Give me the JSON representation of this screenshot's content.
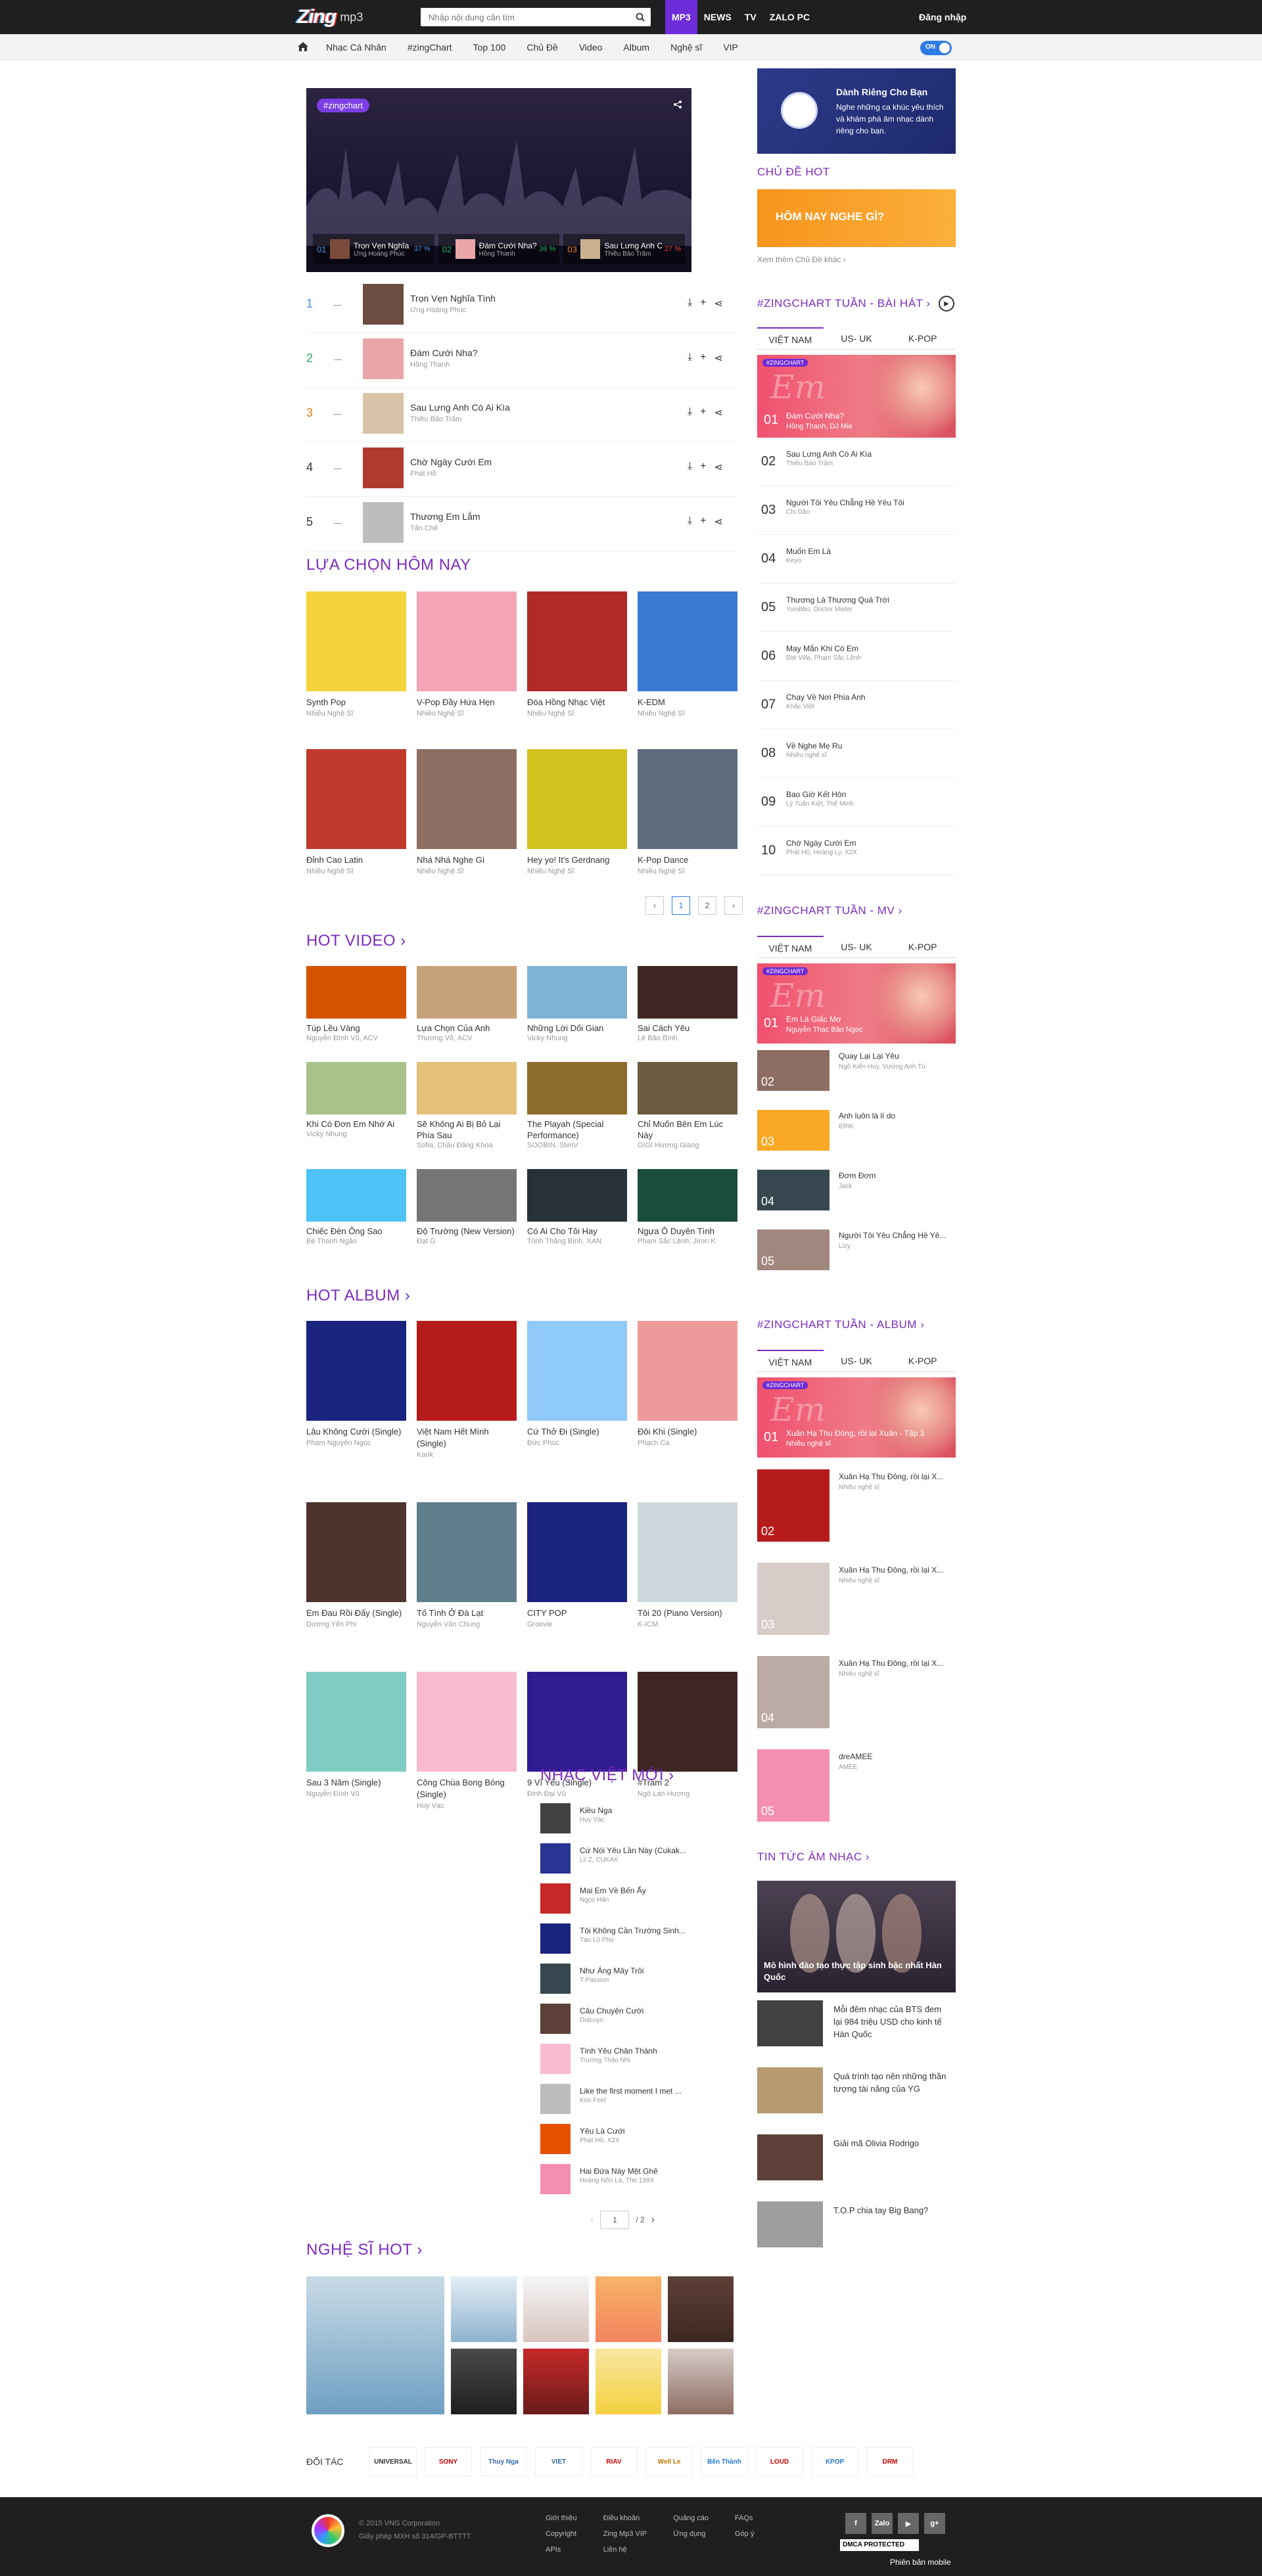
{
  "header": {
    "logo_main": "Zing",
    "logo_sub": "mp3",
    "search_placeholder": "Nhập nội dung cần tìm",
    "nav": [
      "MP3",
      "NEWS",
      "TV",
      "ZALO PC"
    ],
    "login": "Đăng nhập"
  },
  "subnav": [
    "Nhạc Cá Nhân",
    "#zingChart",
    "Top 100",
    "Chủ Đề",
    "Video",
    "Album",
    "Nghệ sĩ",
    "VIP"
  ],
  "toggle_label": "ON",
  "chart": {
    "badge": "#zingchart",
    "top3": [
      {
        "rank": "01",
        "name": "Trọn Vẹn Nghĩa ...",
        "artist": "Ưng Hoàng Phúc",
        "pct": "37 %"
      },
      {
        "rank": "02",
        "name": "Đám Cưới Nha?",
        "artist": "Hồng Thanh",
        "pct": "36 %"
      },
      {
        "rank": "03",
        "name": "Sau Lưng Anh C...",
        "artist": "Thiều Bảo Trâm",
        "pct": "27 %"
      }
    ],
    "list": [
      {
        "rank": "1",
        "name": "Trọn Vẹn Nghĩa Tình",
        "artist": "Ưng Hoàng Phúc",
        "color": "#4a90e2"
      },
      {
        "rank": "2",
        "name": "Đám Cưới Nha?",
        "artist": "Hồng Thanh",
        "color": "#27ae60"
      },
      {
        "rank": "3",
        "name": "Sau Lưng Anh Có Ai Kìa",
        "artist": "Thiều Bảo Trâm",
        "color": "#e67e22"
      },
      {
        "rank": "4",
        "name": "Chờ Ngày Cưới Em",
        "artist": "Phát Hồ",
        "color": "#333333"
      },
      {
        "rank": "5",
        "name": "Thương Em Lắm",
        "artist": "Tấn Chế",
        "color": "#333333"
      }
    ]
  },
  "today": {
    "title": "LỰA CHỌN HÔM NAY",
    "items": [
      {
        "t": "Synth Pop",
        "m": "Nhiều Nghệ Sĩ",
        "bg": "#f5d33a"
      },
      {
        "t": "V-Pop Đầy Hứa Hẹn",
        "m": "Nhiều Nghệ Sĩ",
        "bg": "#f4a4b6"
      },
      {
        "t": "Đóa Hồng Nhạc Việt",
        "m": "Nhiều Nghệ Sĩ",
        "bg": "#b02a2a"
      },
      {
        "t": "K-EDM",
        "m": "Nhiều Nghệ Sĩ",
        "bg": "#3a7bd5"
      },
      {
        "t": "Đỉnh Cao Latin",
        "m": "Nhiều Nghệ Sĩ",
        "bg": "#c0392b"
      },
      {
        "t": "Nhá Nhá Nghe Gì",
        "m": "Nhiều Nghệ Sĩ",
        "bg": "#8d6e63"
      },
      {
        "t": "Hey yo! It's Gerdnang",
        "m": "Nhiều Nghệ Sĩ",
        "bg": "#d4c21e"
      },
      {
        "t": "K-Pop Dance",
        "m": "Nhiều Nghệ Sĩ",
        "bg": "#5d6d7e"
      }
    ],
    "pages": [
      "1",
      "2"
    ]
  },
  "hot_video": {
    "title": "HOT VIDEO",
    "items": [
      {
        "t": "Túp Lều Vàng",
        "m": "Nguyễn Đình Vũ, ACV",
        "bg": "#d35400"
      },
      {
        "t": "Lựa Chọn Của Anh",
        "m": "Thương Võ, ACV",
        "bg": "#c8a27a"
      },
      {
        "t": "Những Lời Dối Gian",
        "m": "Vicky Nhung",
        "bg": "#7fb3d5"
      },
      {
        "t": "Sai Cách Yêu",
        "m": "Lê Bảo Bình",
        "bg": "#3e2723"
      },
      {
        "t": "Khi Có Đơn Em Nhớ Ai",
        "m": "Vicky Nhung",
        "bg": "#a9c18b"
      },
      {
        "t": "Sẽ Không Ai Bị Bỏ Lại Phía Sau",
        "m": "Sofia, Châu Đăng Khoa",
        "bg": "#e5c07b"
      },
      {
        "t": "The Playah (Special Performance)",
        "m": "SOOBIN, SlimV",
        "bg": "#8e6b2e"
      },
      {
        "t": "Chỉ Muốn Bên Em Lúc Này",
        "m": "GIGI Hương Giang",
        "bg": "#6b5b3e"
      },
      {
        "t": "Chiếc Đèn Ông Sao",
        "m": "Bé Thanh Ngân",
        "bg": "#4fc3f7"
      },
      {
        "t": "Độ Trường (New Version)",
        "m": "Đạt G",
        "bg": "#757575"
      },
      {
        "t": "Có Ai Cho Tôi Hay",
        "m": "Trịnh Thăng Bình, XAN",
        "bg": "#263238"
      },
      {
        "t": "Ngựa Ô Duyên Tình",
        "m": "Phạm Sắc Lệnh, Jiron K",
        "bg": "#1b4d3e"
      }
    ]
  },
  "hot_album": {
    "title": "HOT ALBUM",
    "items": [
      {
        "t": "Lâu Không Cười (Single)",
        "m": "Phạm Nguyên Ngọc",
        "bg": "#1a237e"
      },
      {
        "t": "Việt Nam Hết Mình (Single)",
        "m": "Karik",
        "bg": "#b71c1c"
      },
      {
        "t": "Cứ Thở Đi (Single)",
        "m": "Đức Phúc",
        "bg": "#90caf9"
      },
      {
        "t": "Đôi Khi (Single)",
        "m": "Phạch Ca",
        "bg": "#ef9a9a"
      },
      {
        "t": "Em Đau Rồi Đấy (Single)",
        "m": "Dương Yến Phi",
        "bg": "#4e342e"
      },
      {
        "t": "Tố Tình Ở Đà Lạt",
        "m": "Nguyễn Văn Chung",
        "bg": "#607d8b"
      },
      {
        "t": "CITY POP",
        "m": "Groovie",
        "bg": "#1a237e"
      },
      {
        "t": "Tôi 20 (Piano Version)",
        "m": "K-ICM",
        "bg": "#cfd8dc"
      },
      {
        "t": "Sau 3 Năm (Single)",
        "m": "Nguyễn Đình Vũ",
        "bg": "#80cbc4"
      },
      {
        "t": "Công Chúa Bong Bóng (Single)",
        "m": "Huy Vạc",
        "bg": "#f8bbd0"
      },
      {
        "t": "9 Vì Yêu (Single)",
        "m": "Đinh Đại Vũ",
        "bg": "#311b92"
      },
      {
        "t": "#Trăm 2",
        "m": "Ngô Lan Hương",
        "bg": "#3e2723"
      }
    ]
  },
  "new_vn": {
    "title": "NHẠC VIỆT MỚI",
    "items": [
      {
        "t": "Kiều Nga",
        "m": "Huy Vạc",
        "bg": "#424242"
      },
      {
        "t": "Cứ Nói Yêu Lần Này (Cukak...",
        "m": "Lil Z, CUKAK",
        "bg": "#283593"
      },
      {
        "t": "Mai Em Về Bến Ấy",
        "m": "Ngọc Hân",
        "bg": "#c62828"
      },
      {
        "t": "Tôi Không Cần Trường Sinh...",
        "m": "Tào Lộ Phú",
        "bg": "#1a237e"
      },
      {
        "t": "Như Áng Mây Trôi",
        "m": "T-Passion",
        "bg": "#37474f"
      },
      {
        "t": "Câu Chuyện Cười",
        "m": "Dulcoyn",
        "bg": "#5d4037"
      },
      {
        "t": "Tình Yêu Chân Thành",
        "m": "Trương Thảo Nhi",
        "bg": "#f8bbd0"
      },
      {
        "t": "Like the first moment I met ...",
        "m": "Kim Feel",
        "bg": "#bdbdbd"
      },
      {
        "t": "Yêu Là Cưới",
        "m": "Phát Hồ, X2X",
        "bg": "#e65100"
      },
      {
        "t": "Hai Đứa Này Mệt Ghê",
        "m": "Hoàng Nôn Lá, The 199X",
        "bg": "#f48fb1"
      }
    ],
    "page": "1",
    "total": "/ 2"
  },
  "artists": {
    "title": "NGHỆ SĨ HOT"
  },
  "partners": {
    "label": "ĐỐI TÁC",
    "logos": [
      "UNIVERSAL",
      "SONY",
      "Thuy Nga",
      "VIET",
      "RIAV",
      "Well Le",
      "Bến Thành",
      "LOUD",
      "KPOP",
      "DRM"
    ]
  },
  "sidebar": {
    "vip_title": "Dành Riêng Cho Bạn",
    "vip_desc": "Nghe những ca khúc yêu thích và khám phá âm nhạc dành riêng cho bạn.",
    "topic_title": "CHỦ ĐỀ HOT",
    "topic_banner": "HÔM NAY NGHE GÌ?",
    "topic_more": "Xem thêm Chủ Đề khác",
    "tabs": [
      "VIỆT NAM",
      "US- UK",
      "K-POP"
    ],
    "songs_title": "#ZINGCHART TUẦN - BÀI HÁT",
    "songs": [
      {
        "rank": "01",
        "name": "Đám Cưới Nha?",
        "artist": "Hồng Thanh, DJ Mie"
      },
      {
        "rank": "02",
        "name": "Sau Lưng Anh Có Ai Kìa",
        "artist": "Thiều Bảo Trâm"
      },
      {
        "rank": "03",
        "name": "Người Tôi Yêu Chẳng Hề Yêu Tôi",
        "artist": "Chi Dân"
      },
      {
        "rank": "04",
        "name": "Muốn Em Là",
        "artist": "Keyo"
      },
      {
        "rank": "05",
        "name": "Thương Là Thương Quá Trời",
        "artist": "Yunibbo, Doctor Mister"
      },
      {
        "rank": "06",
        "name": "May Mắn Khi Có Em",
        "artist": "Đạt Villa, Phạm Sắc Lệnh"
      },
      {
        "rank": "07",
        "name": "Chạy Về Nơi Phía Anh",
        "artist": "Khắc Việt"
      },
      {
        "rank": "08",
        "name": "Về Nghe Mẹ Ru",
        "artist": "Nhiều nghệ sĩ"
      },
      {
        "rank": "09",
        "name": "Bao Giờ Kết Hôn",
        "artist": "Lý Tuấn Kiệt, Thế Minh"
      },
      {
        "rank": "10",
        "name": "Chờ Ngày Cưới Em",
        "artist": "Phát Hồ, Hoàng Ly, X2X"
      }
    ],
    "mv_title": "#ZINGCHART TUẦN - MV",
    "mvs": [
      {
        "rank": "01",
        "name": "Em Là Giấc Mơ",
        "artist": "Nguyễn Thạc Bảo Ngọc",
        "bg": "#ef6f7a"
      },
      {
        "rank": "02",
        "name": "Quay Lại Lại Yêu",
        "artist": "Ngô Kiến Huy, Vương Anh Tú",
        "bg": "#8d6e63"
      },
      {
        "rank": "03",
        "name": "Anh luôn là lí do",
        "artist": "ERIK",
        "bg": "#f9a825"
      },
      {
        "rank": "04",
        "name": "Đơm Đơm",
        "artist": "Jack",
        "bg": "#37474f"
      },
      {
        "rank": "05",
        "name": "Người Tôi Yêu Chẳng Hề Yê...",
        "artist": "Lizy",
        "bg": "#a1887f"
      }
    ],
    "album_title": "#ZINGCHART TUẦN - ALBUM",
    "albums": [
      {
        "rank": "01",
        "name": "Xuân Hạ Thu Đông, rồi lại Xuân - Tập 3",
        "artist": "Nhiều nghệ sĩ",
        "bg": "#ef6f7a"
      },
      {
        "rank": "02",
        "name": "Xuân Hạ Thu Đông, rồi lại X...",
        "artist": "Nhiều nghệ sĩ",
        "bg": "#b71c1c"
      },
      {
        "rank": "03",
        "name": "Xuân Hạ Thu Đông, rồi lại X...",
        "artist": "Nhiều nghệ sĩ",
        "bg": "#d7ccc8"
      },
      {
        "rank": "04",
        "name": "Xuân Hạ Thu Đông, rồi lại X...",
        "artist": "Nhiều nghệ sĩ",
        "bg": "#bcaaa4"
      },
      {
        "rank": "05",
        "name": "dreAMEE",
        "artist": "AMEE",
        "bg": "#f48fb1"
      }
    ],
    "news_title": "TIN TỨC ÂM NHẠC",
    "news_big": "Mô hình đào tạo thực tập sinh bậc nhất Hàn Quốc",
    "news": [
      {
        "t": "Mỗi đêm nhạc của BTS đem lại 984 triệu USD cho kinh tế Hàn Quốc",
        "bg": "#424242"
      },
      {
        "t": "Quá trình tạo nên những thần tượng tài năng của YG",
        "bg": "#b89a70"
      },
      {
        "t": "Giải mã Olivia Rodrigo",
        "bg": "#5d4037"
      },
      {
        "t": "T.O.P chia tay Big Bang?",
        "bg": "#9e9e9e"
      }
    ]
  },
  "footer": {
    "copy": "© 2015 VNG Corporation",
    "license": "Giấy phép MXH số 314/GP-BTTTT",
    "cols": [
      [
        "Giới thiệu",
        "Copyright",
        "APIs"
      ],
      [
        "Điều khoản",
        "Zing Mp3 VIP",
        "Liên hệ"
      ],
      [
        "Quảng cáo",
        "Ứng dụng"
      ],
      [
        "FAQs",
        "Góp ý"
      ]
    ],
    "social": [
      "f",
      "Zalo",
      "▶",
      "g+"
    ],
    "dmca": "DMCA PROTECTED",
    "mobile": "Phiên bản mobile"
  }
}
